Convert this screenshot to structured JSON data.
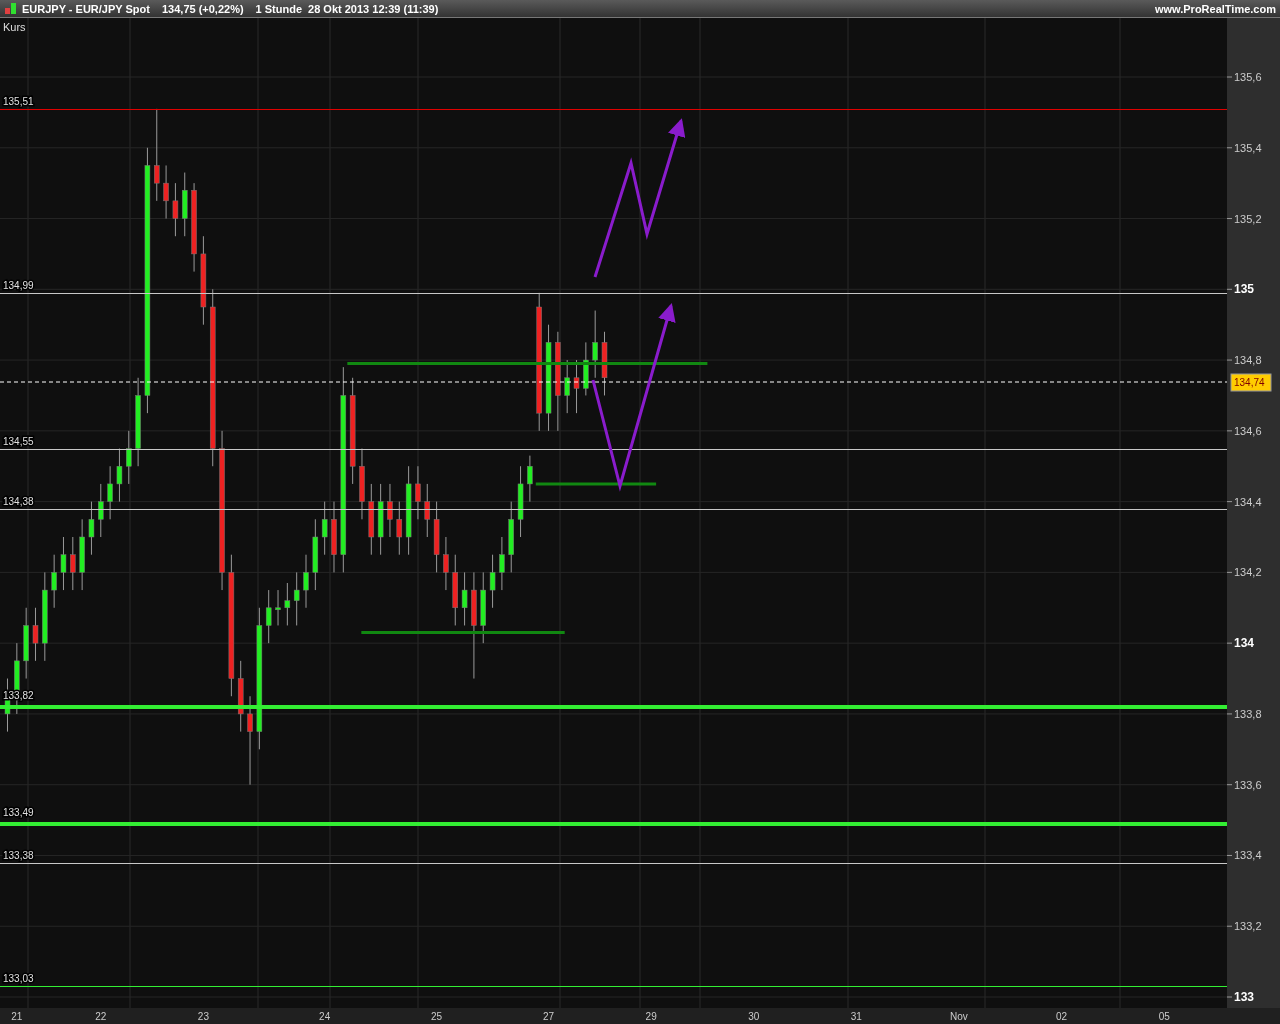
{
  "header": {
    "instrument": "EURJPY - EUR/JPY Spot",
    "price": "134,75 (+0,22%)",
    "period": "1 Stunde",
    "datetime": "28 Okt 2013 12:39 (11:39)",
    "website": "www.ProRealTime.com"
  },
  "chart": {
    "panel_label": "Kurs",
    "current_price": "134,74",
    "levels": [
      {
        "label": "135,51",
        "color": "#e00000",
        "kind": "thin"
      },
      {
        "label": "134,99",
        "color": "#c8c8c8",
        "kind": "thin"
      },
      {
        "label": "134,55",
        "color": "#c8c8c8",
        "kind": "thin"
      },
      {
        "label": "134,38",
        "color": "#c8c8c8",
        "kind": "thin"
      },
      {
        "label": "133,82",
        "color": "#33ee33",
        "kind": "thick"
      },
      {
        "label": "133,49",
        "color": "#33ee33",
        "kind": "thick"
      },
      {
        "label": "133,38",
        "color": "#c8c8c8",
        "kind": "thin"
      },
      {
        "label": "133,03",
        "color": "#33ee33",
        "kind": "thin"
      }
    ],
    "chart_data": {
      "type": "candlestick",
      "ylim": [
        133,
        135.6
      ],
      "grid": true,
      "yticks": [
        {
          "value": 135.6,
          "label": "135,6"
        },
        {
          "value": 135.4,
          "label": "135,4"
        },
        {
          "value": 135.2,
          "label": "135,2"
        },
        {
          "value": 135,
          "label": "135"
        },
        {
          "value": 134.8,
          "label": "134,8"
        },
        {
          "value": 134.6,
          "label": "134,6"
        },
        {
          "value": 134.4,
          "label": "134,4"
        },
        {
          "value": 134.2,
          "label": "134,2"
        },
        {
          "value": 134,
          "label": "134"
        },
        {
          "value": 133.8,
          "label": "133,8"
        },
        {
          "value": 133.6,
          "label": "133,6"
        },
        {
          "value": 133.4,
          "label": "133,4"
        },
        {
          "value": 133.2,
          "label": "133,2"
        },
        {
          "value": 133,
          "label": "133"
        }
      ],
      "categories": [
        null,
        "21",
        null,
        null,
        null,
        null,
        null,
        null,
        null,
        null,
        "22",
        null,
        null,
        null,
        null,
        null,
        null,
        null,
        null,
        null,
        null,
        "23",
        null,
        null,
        null,
        null,
        null,
        null,
        null,
        null,
        null,
        null,
        null,
        null,
        "24",
        null,
        null,
        null,
        null,
        null,
        null,
        null,
        null,
        null,
        null,
        null,
        "25",
        null,
        null,
        null,
        null,
        null,
        null,
        null,
        null,
        null,
        null,
        null,
        "27",
        null,
        null,
        null,
        null,
        null,
        null,
        null,
        null,
        null,
        null,
        "29",
        null,
        null,
        null,
        null,
        null,
        null,
        null,
        null,
        null,
        null,
        "30",
        null,
        null,
        null,
        null,
        null,
        null,
        null,
        null,
        null,
        null,
        "31",
        null,
        null,
        null,
        null,
        null,
        null,
        null,
        null,
        null,
        null,
        "Nov",
        null,
        null,
        null,
        null,
        null,
        null,
        null,
        null,
        null,
        null,
        "02",
        null,
        null,
        null,
        null,
        null,
        null,
        null,
        null,
        null,
        null,
        "05",
        null,
        null,
        null,
        null,
        null,
        null
      ],
      "ohlc": [
        [
          133.8,
          133.9,
          133.75,
          133.85
        ],
        [
          133.85,
          134.0,
          133.8,
          133.95
        ],
        [
          133.95,
          134.1,
          133.9,
          134.05
        ],
        [
          134.05,
          134.1,
          133.95,
          134.0
        ],
        [
          134.0,
          134.2,
          133.95,
          134.15
        ],
        [
          134.15,
          134.25,
          134.1,
          134.2
        ],
        [
          134.2,
          134.3,
          134.15,
          134.25
        ],
        [
          134.25,
          134.3,
          134.15,
          134.2
        ],
        [
          134.2,
          134.35,
          134.15,
          134.3
        ],
        [
          134.3,
          134.4,
          134.25,
          134.35
        ],
        [
          134.35,
          134.45,
          134.3,
          134.4
        ],
        [
          134.4,
          134.5,
          134.35,
          134.45
        ],
        [
          134.45,
          134.55,
          134.4,
          134.5
        ],
        [
          134.5,
          134.6,
          134.45,
          134.55
        ],
        [
          134.55,
          134.75,
          134.5,
          134.7
        ],
        [
          134.7,
          135.4,
          134.65,
          135.35
        ],
        [
          135.35,
          135.51,
          135.25,
          135.3
        ],
        [
          135.3,
          135.35,
          135.2,
          135.25
        ],
        [
          135.25,
          135.3,
          135.15,
          135.2
        ],
        [
          135.2,
          135.33,
          135.15,
          135.28
        ],
        [
          135.28,
          135.3,
          135.05,
          135.1
        ],
        [
          135.1,
          135.15,
          134.9,
          134.95
        ],
        [
          134.95,
          135.0,
          134.5,
          134.55
        ],
        [
          134.55,
          134.6,
          134.15,
          134.2
        ],
        [
          134.2,
          134.25,
          133.85,
          133.9
        ],
        [
          133.9,
          133.95,
          133.75,
          133.8
        ],
        [
          133.8,
          133.85,
          133.6,
          133.75
        ],
        [
          133.75,
          134.1,
          133.7,
          134.05
        ],
        [
          134.05,
          134.15,
          134.0,
          134.1
        ],
        [
          134.1,
          134.15,
          134.05,
          134.1
        ],
        [
          134.1,
          134.17,
          134.05,
          134.12
        ],
        [
          134.12,
          134.2,
          134.05,
          134.15
        ],
        [
          134.15,
          134.25,
          134.1,
          134.2
        ],
        [
          134.2,
          134.35,
          134.15,
          134.3
        ],
        [
          134.3,
          134.4,
          134.25,
          134.35
        ],
        [
          134.35,
          134.4,
          134.2,
          134.25
        ],
        [
          134.25,
          134.78,
          134.2,
          134.7
        ],
        [
          134.7,
          134.75,
          134.45,
          134.5
        ],
        [
          134.5,
          134.55,
          134.35,
          134.4
        ],
        [
          134.4,
          134.45,
          134.25,
          134.3
        ],
        [
          134.3,
          134.45,
          134.25,
          134.4
        ],
        [
          134.4,
          134.45,
          134.3,
          134.35
        ],
        [
          134.35,
          134.4,
          134.25,
          134.3
        ],
        [
          134.3,
          134.5,
          134.25,
          134.45
        ],
        [
          134.45,
          134.5,
          134.35,
          134.4
        ],
        [
          134.4,
          134.45,
          134.3,
          134.35
        ],
        [
          134.35,
          134.4,
          134.2,
          134.25
        ],
        [
          134.25,
          134.3,
          134.15,
          134.2
        ],
        [
          134.2,
          134.25,
          134.05,
          134.1
        ],
        [
          134.1,
          134.2,
          134.05,
          134.15
        ],
        [
          134.15,
          134.2,
          133.9,
          134.05
        ],
        [
          134.05,
          134.2,
          134.0,
          134.15
        ],
        [
          134.15,
          134.25,
          134.1,
          134.2
        ],
        [
          134.2,
          134.3,
          134.15,
          134.25
        ],
        [
          134.25,
          134.4,
          134.2,
          134.35
        ],
        [
          134.35,
          134.5,
          134.3,
          134.45
        ],
        [
          134.45,
          134.53,
          134.4,
          134.5
        ],
        [
          134.95,
          134.99,
          134.6,
          134.65
        ],
        [
          134.65,
          134.9,
          134.6,
          134.85
        ],
        [
          134.85,
          134.88,
          134.6,
          134.7
        ],
        [
          134.7,
          134.8,
          134.65,
          134.75
        ],
        [
          134.75,
          134.8,
          134.65,
          134.72
        ],
        [
          134.72,
          134.85,
          134.7,
          134.8
        ],
        [
          134.8,
          134.94,
          134.75,
          134.85
        ],
        [
          134.85,
          134.88,
          134.7,
          134.75
        ],
        null,
        null,
        null,
        null,
        null,
        null,
        null,
        null,
        null,
        null,
        null,
        null,
        null,
        null,
        null,
        null,
        null,
        null,
        null,
        null,
        null,
        null,
        null,
        null,
        null,
        null,
        null,
        null,
        null,
        null,
        null,
        null,
        null,
        null,
        null,
        null,
        null,
        null,
        null,
        null,
        null,
        null,
        null,
        null,
        null,
        null,
        null,
        null,
        null,
        null,
        null,
        null,
        null,
        null,
        null,
        null,
        null,
        null,
        null,
        null,
        null,
        null,
        null,
        null,
        null,
        null
      ]
    }
  }
}
